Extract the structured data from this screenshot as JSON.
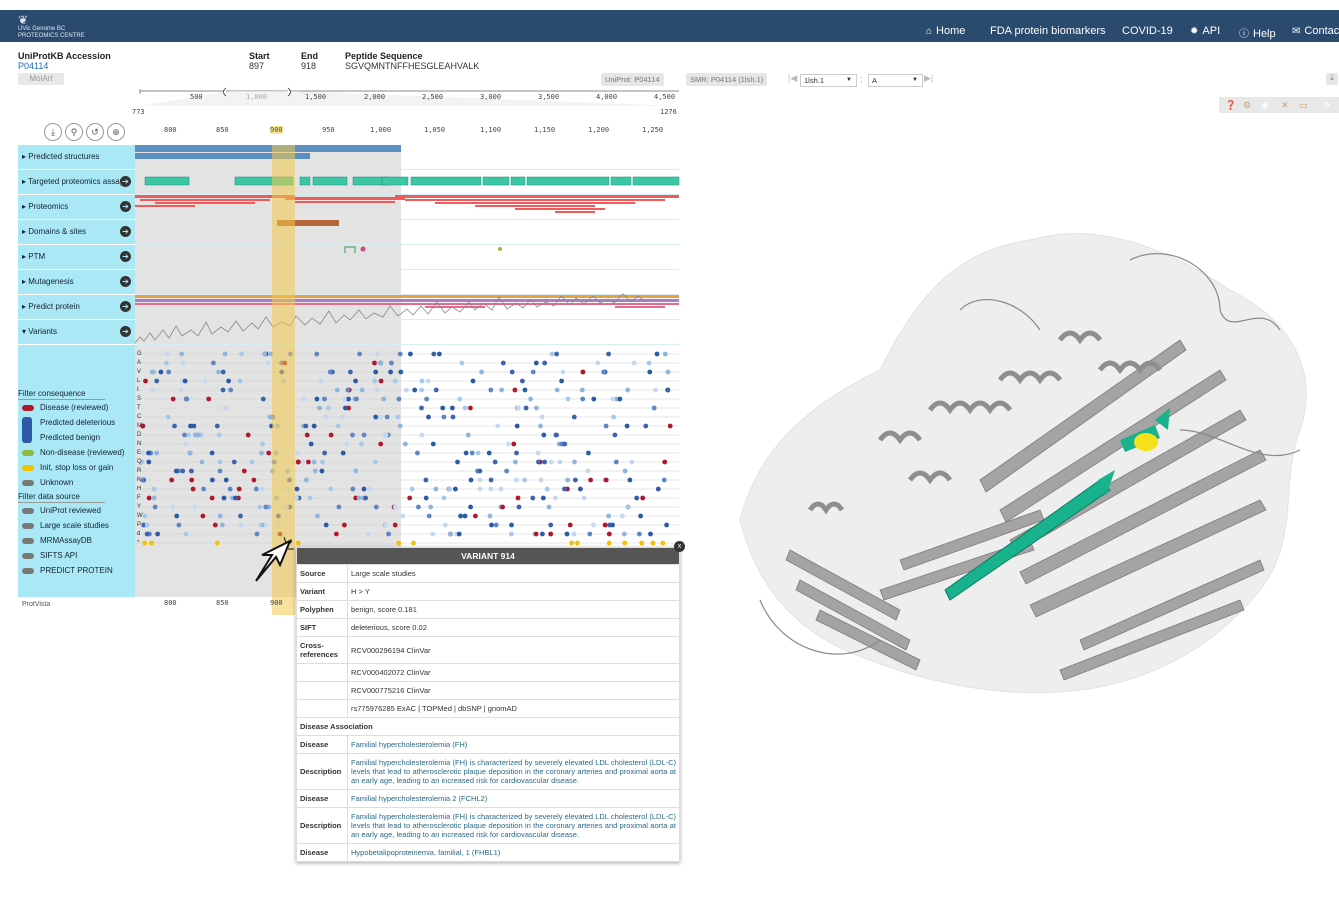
{
  "nav": {
    "logo_lines": [
      "UVic",
      "Genome BC",
      "PROTEOMICS CENTRE"
    ],
    "items": [
      {
        "icon": "home-icon",
        "glyph": "⌂",
        "label": "Home"
      },
      {
        "icon": "",
        "glyph": "",
        "label": "FDA protein biomarkers"
      },
      {
        "icon": "",
        "glyph": "",
        "label": "COVID-19"
      },
      {
        "icon": "gear-icon",
        "glyph": "✹",
        "label": "API"
      },
      {
        "icon": "info-icon",
        "glyph": "ⓘ",
        "label": "Help"
      },
      {
        "icon": "envelope-icon",
        "glyph": "✉",
        "label": "Contac"
      }
    ]
  },
  "header": {
    "accession_label": "UniProtKB Accession",
    "accession_value": "P04114",
    "start_label": "Start",
    "start_value": "897",
    "end_label": "End",
    "end_value": "918",
    "peptide_label": "Peptide Sequence",
    "peptide_value": "SGVQMNTNFFHESGLEAHVALK",
    "molart_label": "MolArt"
  },
  "structure_bar": {
    "uniprot_label": "UniProt:",
    "uniprot_value": "P04114",
    "smr_label": "SMR:",
    "smr_value": "P04114 (1lsh.1)",
    "model_select": "1lsh.1",
    "chain_select": "A",
    "colon": ":"
  },
  "overview_ruler": {
    "ticks": [
      "500",
      "1,000",
      "1,500",
      "2,000",
      "2,500",
      "3,000",
      "3,500",
      "4,000",
      "4,500"
    ],
    "range_start": "773",
    "range_end": "1276"
  },
  "zoom_ruler": {
    "ticks": [
      "800",
      "850",
      "900",
      "950",
      "1,000",
      "1,050",
      "1,100",
      "1,150",
      "1,200",
      "1,250"
    ]
  },
  "tracks": [
    {
      "label": "Predicted structures",
      "arrow": "▸",
      "go": false
    },
    {
      "label": "Targeted proteomics assay",
      "arrow": "▸",
      "go": true
    },
    {
      "label": "Proteomics",
      "arrow": "▸",
      "go": true
    },
    {
      "label": "Domains & sites",
      "arrow": "▸",
      "go": true
    },
    {
      "label": "PTM",
      "arrow": "▸",
      "go": true
    },
    {
      "label": "Mutagenesis",
      "arrow": "▸",
      "go": true
    },
    {
      "label": "Predict protein",
      "arrow": "▸",
      "go": true
    },
    {
      "label": "Variants",
      "arrow": "▾",
      "go": true
    }
  ],
  "variant_residues": [
    "G",
    "A",
    "V",
    "L",
    "I",
    "S",
    "T",
    "C",
    "M",
    "D",
    "N",
    "E",
    "Q",
    "R",
    "K",
    "H",
    "F",
    "Y",
    "W",
    "P",
    "d",
    "*"
  ],
  "legend": {
    "consequence_header": "Filter consequence",
    "consequence_items": [
      {
        "label": "Disease (reviewed)",
        "color": "#b2182b"
      },
      {
        "label": "Predicted deleterious",
        "color": "#2b5aa6"
      },
      {
        "label": "Predicted benign",
        "color": "#a6c8ea"
      },
      {
        "label": "Non-disease (reviewed)",
        "color": "#8cbd3a"
      },
      {
        "label": "Init, stop loss or gain",
        "color": "#f2c200"
      },
      {
        "label": "Unknown",
        "color": "#777777"
      }
    ],
    "source_header": "Filter data source",
    "source_items": [
      "UniProt reviewed",
      "Large scale studies",
      "MRMAssayDB",
      "SIFTS API",
      "PREDICT PROTEIN"
    ]
  },
  "bottom_ruler": {
    "ticks": [
      "800",
      "850",
      "900"
    ]
  },
  "footer_label": "ProtVista",
  "variant_popup": {
    "title": "VARIANT 914",
    "rows": [
      {
        "k": "Source",
        "v": "Large scale studies"
      },
      {
        "k": "Variant",
        "v": "H > Y"
      },
      {
        "k": "Polyphen",
        "v": "benign, score 0.181"
      },
      {
        "k": "SIFT",
        "v": "deleterious, score 0.02"
      },
      {
        "k": "Cross-references",
        "v": "RCV000296194 ClinVar"
      },
      {
        "k": "",
        "v": "RCV000402072 ClinVar"
      },
      {
        "k": "",
        "v": "RCV000775216 ClinVar"
      },
      {
        "k": "",
        "v": "rs775976285 ExAC | TOPMed | dbSNP | gnomAD"
      }
    ],
    "disease_header": "Disease Association",
    "disease_rows": [
      {
        "k": "Disease",
        "v": "Familial hypercholesterolemia (FH)"
      },
      {
        "k": "Description",
        "v": "Familial hypercholesterolemia (FH) is characterized by severely elevated LDL cholesterol (LDL-C) levels that lead to atherosclerotic plaque deposition in the coronary arteries and proximal aorta at an early age, leading to an increased risk for cardiovascular disease."
      },
      {
        "k": "Disease",
        "v": "Familial hypercholesterolemia 2 (FCHL2)"
      },
      {
        "k": "Description",
        "v": "Familial hypercholesterolemia (FH) is characterized by severely elevated LDL cholesterol (LDL-C) levels that lead to atherosclerotic plaque deposition in the coronary arteries and proximal aorta at an early age, leading to an increased risk for cardiovascular disease."
      },
      {
        "k": "Disease",
        "v": "Hypobetalipoproteinemia, familial, 1 (FHBL1)"
      }
    ]
  },
  "colors": {
    "navbar": "#2a4a6e",
    "track_label_bg": "#abe8f5",
    "highlight": "#f2c94c",
    "assay": "#3cc6a4",
    "proteomics": "#f15a5a",
    "structure": "#5b8fc2",
    "helix_gray": "#9a9a9a",
    "peptide_green": "#18b38c",
    "peptide_yellow": "#f4e11a"
  }
}
